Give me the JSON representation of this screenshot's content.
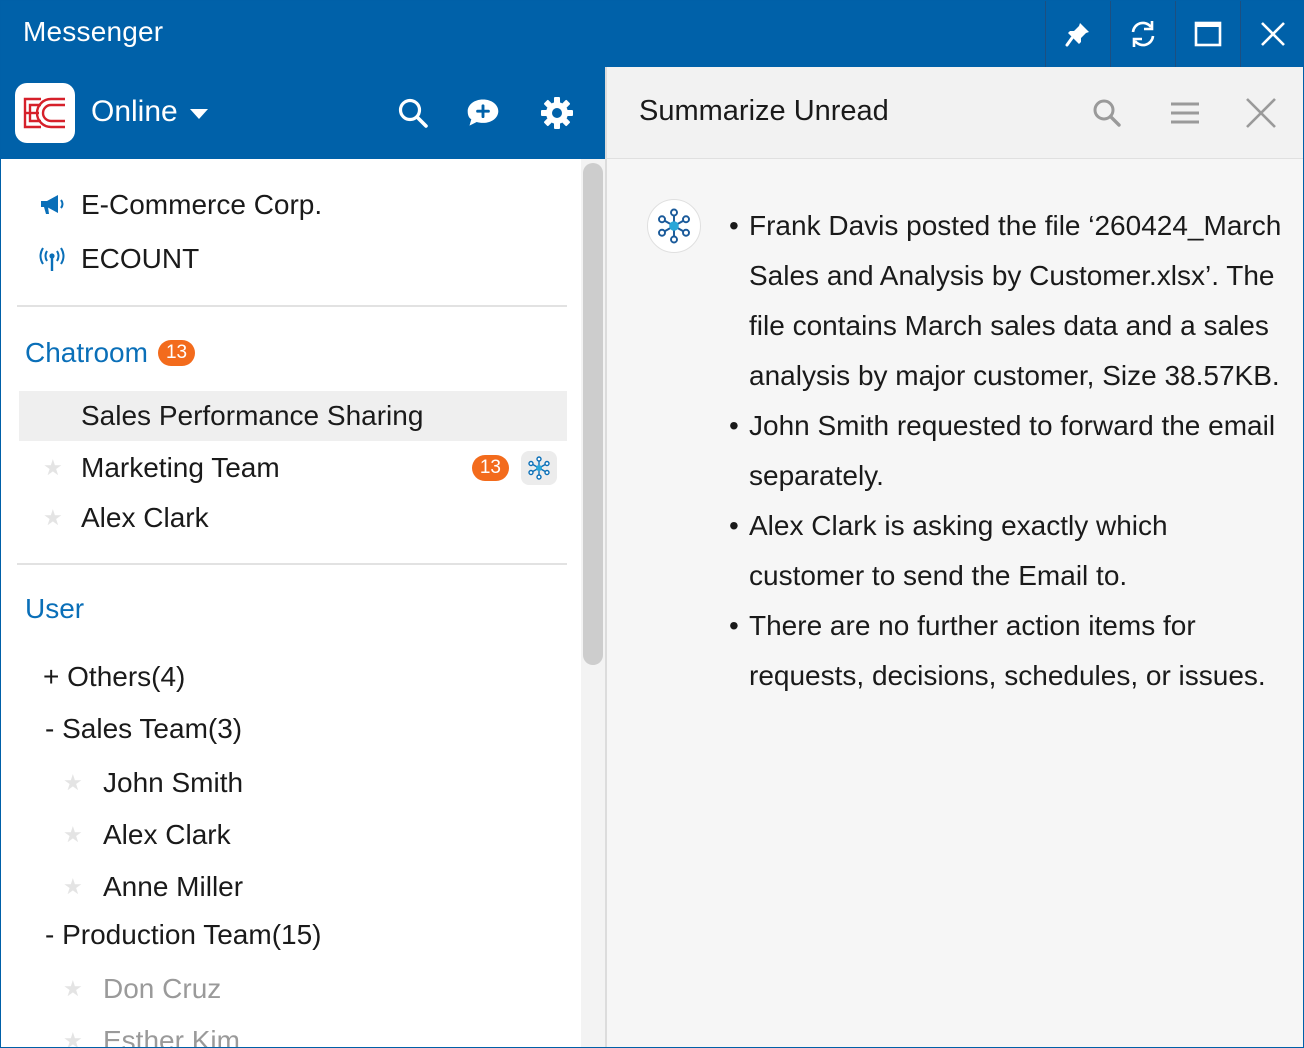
{
  "window": {
    "title": "Messenger",
    "controls": [
      "pin-icon",
      "refresh-icon",
      "maximize-icon",
      "close-icon"
    ]
  },
  "header": {
    "status": "Online"
  },
  "notices": [
    {
      "icon": "megaphone-icon",
      "label": "E-Commerce Corp."
    },
    {
      "icon": "broadcast-icon",
      "label": "ECOUNT"
    }
  ],
  "chatroom": {
    "title": "Chatroom",
    "badge": "13",
    "rooms": [
      {
        "label": "Sales Performance Sharing",
        "selected": true
      },
      {
        "label": "Marketing Team",
        "badge": "13",
        "ai": true
      },
      {
        "label": "Alex Clark"
      }
    ]
  },
  "users": {
    "title": "User",
    "groups": [
      {
        "label": "+ Others(4)"
      },
      {
        "label": "- Sales Team(3)",
        "members": [
          "John Smith",
          "Alex Clark",
          "Anne Miller"
        ]
      },
      {
        "label": "- Production Team(15)",
        "members": [
          "Don Cruz",
          "Esther Kim"
        ]
      }
    ]
  },
  "panel": {
    "title": "Summarize Unread",
    "summary": [
      "Frank Davis posted the file ‘260424_March Sales and Analysis by Customer.xlsx’. The file contains March sales data and a sales analysis by major customer, Size 38.57KB.",
      "John Smith requested to forward the email separately.",
      "Alex Clark is asking exactly which customer to send the Email to.",
      "There are no further action items for requests, decisions, schedules, or issues."
    ]
  },
  "colors": {
    "brand": "#0061a9",
    "accent_text": "#0a6fb8",
    "badge": "#f36b1c"
  }
}
